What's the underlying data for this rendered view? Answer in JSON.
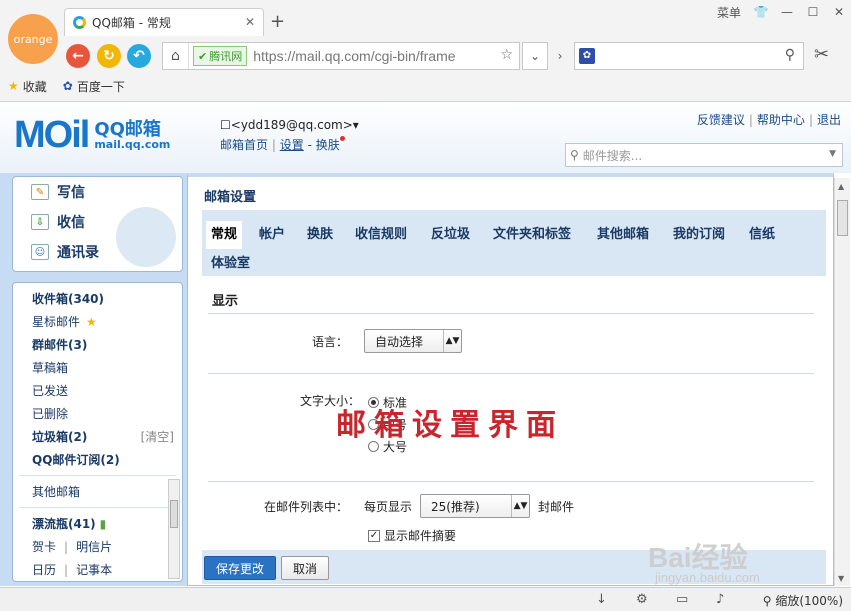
{
  "browser": {
    "brand_badge": "orange",
    "tab_title": "QQ邮箱 - 常规",
    "tab_close": "✕",
    "new_tab": "+",
    "window_menu": "菜单",
    "address_safe_label": "腾讯网",
    "address_url": "https://mail.qq.com/cgi-bin/frame",
    "bookmarks": [
      "收藏",
      "百度一下"
    ],
    "zoom": "缩放(100%)"
  },
  "mail_header": {
    "brand_logo": "MOil",
    "brand_cn": "QQ邮箱",
    "brand_domain": "mail.qq.com",
    "account": "<ydd189@qq.com>",
    "account_links": [
      "邮箱首页",
      "设置",
      "换肤"
    ],
    "top_links": [
      "反馈建议",
      "帮助中心",
      "退出"
    ],
    "search_placeholder": "邮件搜索..."
  },
  "sidebar": {
    "actions": [
      "写信",
      "收信",
      "通讯录"
    ],
    "folders": [
      {
        "label": "收件箱(340)",
        "bold": true
      },
      {
        "label": "星标邮件",
        "bold": false
      },
      {
        "label": "群邮件(3)",
        "bold": true
      },
      {
        "label": "草稿箱",
        "bold": false
      },
      {
        "label": "已发送",
        "bold": false
      },
      {
        "label": "已删除",
        "bold": false
      },
      {
        "label": "垃圾箱(2)",
        "bold": true,
        "extra": "[清空]"
      },
      {
        "label": "QQ邮件订阅(2)",
        "bold": true
      }
    ],
    "other_mailbox": "其他邮箱",
    "drift_bottle": "漂流瓶(41)",
    "apps_row1": [
      "贺卡",
      "明信片"
    ],
    "apps_row2": [
      "日历",
      "记事本"
    ]
  },
  "settings": {
    "page_title": "邮箱设置",
    "tabs": [
      "常规",
      "帐户",
      "换肤",
      "收信规则",
      "反垃圾",
      "文件夹和标签",
      "其他邮箱",
      "我的订阅",
      "信纸",
      "体验室"
    ],
    "active_tab": "常规",
    "section_display": "显示",
    "language_label": "语言：",
    "language_value": "自动选择",
    "fontsize_label": "文字大小：",
    "fontsize_options": [
      "标准",
      "中号",
      "大号"
    ],
    "fontsize_selected": "标准",
    "list_label": "在邮件列表中：",
    "per_page_prefix": "每页显示",
    "per_page_value": "25(推荐)",
    "per_page_suffix": "封邮件",
    "show_summary": "显示邮件摘要",
    "show_summary_checked": true,
    "save_button": "保存更改",
    "cancel_button": "取消"
  },
  "overlay_caption": "邮箱设置界面",
  "watermark": {
    "main": "Bai经验",
    "sub": "jingyan.baidu.com"
  }
}
